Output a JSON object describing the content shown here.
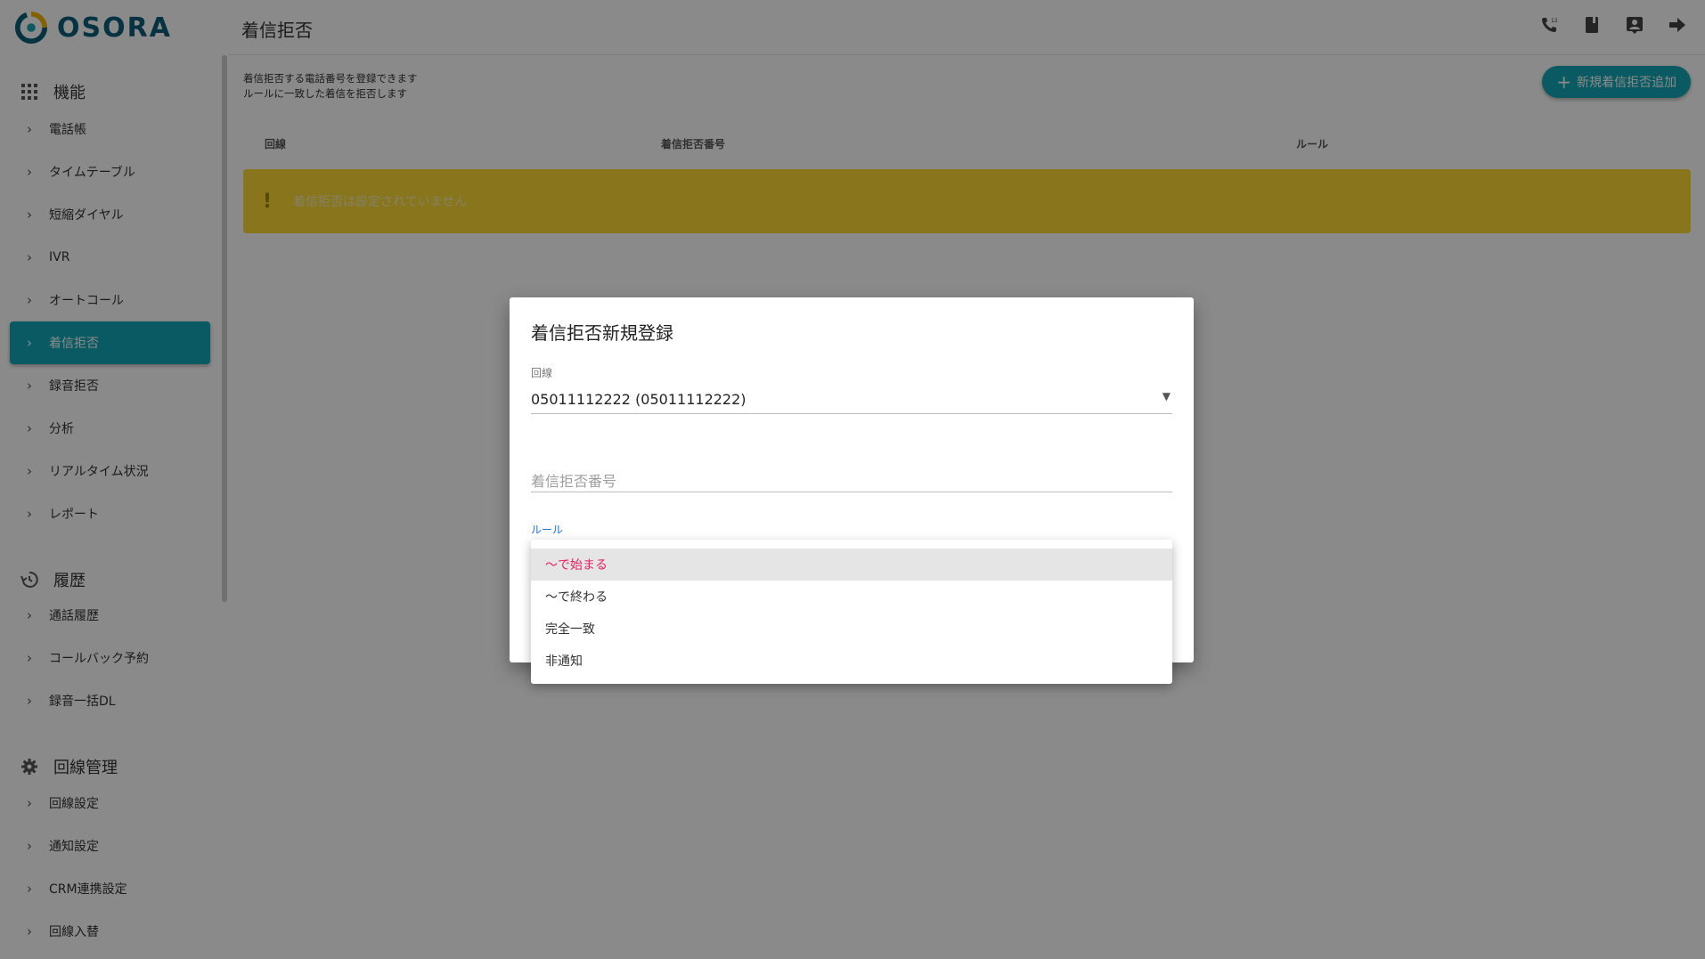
{
  "app": {
    "logo_text": "OSORA"
  },
  "header": {
    "title": "着信拒否",
    "icons": [
      "phone-icon",
      "book-icon",
      "contact-icon",
      "logout-icon"
    ]
  },
  "sidebar": {
    "sections": [
      {
        "title": "機能",
        "icon": "grid-icon"
      },
      {
        "title": "履歴",
        "icon": "history-icon"
      },
      {
        "title": "回線管理",
        "icon": "gear-icon"
      }
    ],
    "items": [
      {
        "label": "電話帳"
      },
      {
        "label": "タイムテーブル"
      },
      {
        "label": "短縮ダイヤル"
      },
      {
        "label": "IVR"
      },
      {
        "label": "オートコール"
      },
      {
        "label": "着信拒否",
        "active": true
      },
      {
        "label": "録音拒否"
      },
      {
        "label": "分析"
      },
      {
        "label": "リアルタイム状況"
      },
      {
        "label": "レポート"
      },
      {
        "label": "通話履歴"
      },
      {
        "label": "コールバック予約"
      },
      {
        "label": "録音一括DL"
      },
      {
        "label": "回線設定"
      },
      {
        "label": "通知設定"
      },
      {
        "label": "CRM連携設定"
      },
      {
        "label": "回線入替"
      }
    ]
  },
  "main": {
    "desc_line1": "着信拒否する電話番号を登録できます",
    "desc_line2": "ルールに一致した着信を拒否します",
    "add_button": "新規着信拒否追加",
    "columns": [
      "回線",
      "着信拒否番号",
      "ルール"
    ],
    "empty_alert": "着信拒否は設定されていません"
  },
  "dialog": {
    "title": "着信拒否新規登録",
    "line_label": "回線",
    "line_value": "05011112222 (05011112222)",
    "number_placeholder": "着信拒否番号",
    "rule_label": "ルール",
    "rule_options": [
      "〜で始まる",
      "〜で終わる",
      "完全一致",
      "非通知"
    ],
    "rule_highlighted": "〜で始まる"
  },
  "colors": {
    "accent": "#12a7b6",
    "alert": "#fdd835",
    "highlight_text": "#e91e63",
    "brand": "#0b5f7a"
  }
}
